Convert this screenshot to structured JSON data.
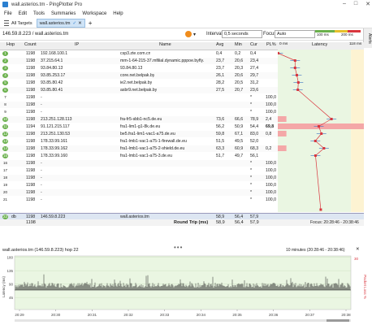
{
  "window": {
    "title": "wall.asterios.tm - PingPlotter Pro"
  },
  "menu": [
    "File",
    "Edit",
    "Tools",
    "Summaries",
    "Workspace",
    "Help"
  ],
  "tabs": {
    "all_targets": "All Targets",
    "active": "wall.asterios.tm"
  },
  "toolbar": {
    "address": "146.59.8.223 / wall.asterios.tm",
    "interval_label": "Interval",
    "interval_value": "0,5 seconds",
    "focus_label": "Focus",
    "focus_value": "Auto",
    "scale_low": "100 ms",
    "scale_high": "200 ms",
    "alerts": "Alerts"
  },
  "columns": {
    "hop": "Hop",
    "count": "Count",
    "ip": "IP",
    "name": "Name",
    "avg": "Avg",
    "min": "Min",
    "cur": "Cur",
    "pl": "PL%",
    "latency_start": "0 ms",
    "latency": "Latency",
    "latency_end": "118 ms"
  },
  "hops": [
    {
      "hop": "1",
      "count": "1198",
      "ip": "192.168.100.1",
      "name": "csp3.zte.com.cn",
      "avg": "0,4",
      "min": "0,2",
      "cur": "0,4",
      "pl": "",
      "status": "green",
      "lat": 0.4
    },
    {
      "hop": "2",
      "count": "1198",
      "ip": "37.215.64.1",
      "name": "mm-1-64-215-37.mfilial.dynamic.pppoe.byfly.",
      "avg": "23,7",
      "min": "20,6",
      "cur": "23,4",
      "pl": "",
      "status": "green",
      "lat": 23.7
    },
    {
      "hop": "3",
      "count": "1198",
      "ip": "93.84.80.13",
      "name": "93.84.80.13",
      "avg": "23,7",
      "min": "20,3",
      "cur": "27,4",
      "pl": "",
      "status": "green",
      "lat": 23.7
    },
    {
      "hop": "4",
      "count": "1198",
      "ip": "93.85.253.17",
      "name": "core.net.belpak.by",
      "avg": "26,1",
      "min": "20,6",
      "cur": "29,7",
      "pl": "",
      "status": "green",
      "lat": 26.1
    },
    {
      "hop": "5",
      "count": "1198",
      "ip": "93.85.80.42",
      "name": "ie2.net.belpak.by",
      "avg": "28,2",
      "min": "20,5",
      "cur": "31,2",
      "pl": "",
      "status": "green",
      "lat": 28.2
    },
    {
      "hop": "6",
      "count": "1198",
      "ip": "93.85.80.41",
      "name": "asbr9.net.belpak.by",
      "avg": "27,5",
      "min": "20,7",
      "cur": "23,6",
      "pl": "",
      "status": "green",
      "lat": 27.5
    },
    {
      "hop": "7",
      "count": "1198",
      "ip": "-",
      "name": "",
      "avg": "",
      "min": "",
      "cur": "*",
      "pl": "100,0",
      "status": "none",
      "lat": null
    },
    {
      "hop": "8",
      "count": "1198",
      "ip": "-",
      "name": "",
      "avg": "",
      "min": "",
      "cur": "*",
      "pl": "100,0",
      "status": "none",
      "lat": null
    },
    {
      "hop": "9",
      "count": "1198",
      "ip": "-",
      "name": "",
      "avg": "",
      "min": "",
      "cur": "*",
      "pl": "100,0",
      "status": "none",
      "lat": null
    },
    {
      "hop": "10",
      "count": "1198",
      "ip": "213.251.128.113",
      "name": "fra-fr5-sbb1-nc5.de.eu",
      "avg": "73,6",
      "min": "66,6",
      "cur": "78,9",
      "pl": "2,4",
      "status": "green",
      "lat": 73.6
    },
    {
      "hop": "11",
      "count": "1194",
      "ip": "91.121.215.117",
      "name": "fra1-lim1-g1-8k.de.eu",
      "avg": "56,2",
      "min": "50,9",
      "cur": "54,4",
      "pl": "69,8",
      "status": "green",
      "lat": 56.2
    },
    {
      "hop": "12",
      "count": "1198",
      "ip": "213.251.130.53",
      "name": "be5.fra1-lim1-vac1-a75.de.eu",
      "avg": "59,8",
      "min": "67,1",
      "cur": "83,0",
      "pl": "0,8",
      "status": "green",
      "lat": 59.8
    },
    {
      "hop": "13",
      "count": "1198",
      "ip": "178.33.99.161",
      "name": "fra1-lmb1-vac1-a75-1-firewall.de.eu",
      "avg": "51,5",
      "min": "49,5",
      "cur": "52,0",
      "pl": "",
      "status": "green",
      "lat": 51.5
    },
    {
      "hop": "14",
      "count": "1198",
      "ip": "178.33.99.162",
      "name": "fra1-lmb1-vac1-a75-2-shield.de.eu",
      "avg": "63,3",
      "min": "60,9",
      "cur": "68,3",
      "pl": "0,2",
      "status": "green",
      "lat": 63.3
    },
    {
      "hop": "15",
      "count": "1198",
      "ip": "178.33.99.160",
      "name": "fra1-lmb1-vac1-a75-3.de.eu",
      "avg": "51,7",
      "min": "49,7",
      "cur": "56,1",
      "pl": "",
      "status": "green",
      "lat": 51.7
    },
    {
      "hop": "16",
      "count": "1198",
      "ip": "-",
      "name": "",
      "avg": "",
      "min": "",
      "cur": "*",
      "pl": "100,0",
      "status": "none",
      "lat": null
    },
    {
      "hop": "17",
      "count": "1198",
      "ip": "-",
      "name": "",
      "avg": "",
      "min": "",
      "cur": "*",
      "pl": "100,0",
      "status": "none",
      "lat": null
    },
    {
      "hop": "18",
      "count": "1198",
      "ip": "-",
      "name": "",
      "avg": "",
      "min": "",
      "cur": "*",
      "pl": "100,0",
      "status": "none",
      "lat": null
    },
    {
      "hop": "19",
      "count": "1198",
      "ip": "-",
      "name": "",
      "avg": "",
      "min": "",
      "cur": "*",
      "pl": "100,0",
      "status": "none",
      "lat": null
    },
    {
      "hop": "20",
      "count": "1198",
      "ip": "-",
      "name": "",
      "avg": "",
      "min": "",
      "cur": "*",
      "pl": "100,0",
      "status": "none",
      "lat": null
    },
    {
      "hop": "21",
      "count": "1198",
      "ip": "-",
      "name": "",
      "avg": "",
      "min": "",
      "cur": "*",
      "pl": "100,0",
      "status": "none",
      "lat": null
    }
  ],
  "final_hop": {
    "hop": "22",
    "extra": "db",
    "count": "1198",
    "ip": "146.59.8.223",
    "name": "wall.asterios.tm",
    "avg": "58,9",
    "min": "56,4",
    "cur": "57,9"
  },
  "totals": {
    "count": "1198",
    "label": "Round Trip (ms)",
    "avg": "58,9",
    "min": "56,4",
    "cur": "57,9",
    "focus": "Focus: 20:28:46 - 20:38:46"
  },
  "graph": {
    "title": "wall.asterios.tm (146.59.8.223) hop 22",
    "range": "10 minutes (20:28:46 - 20:38:46)",
    "y_left_label": "Latency (ms)",
    "y_right_label": "Packet Loss %",
    "y_ticks": [
      "180",
      "135",
      "90",
      "45"
    ],
    "y_right_top": "30",
    "x_ticks": [
      "20:29",
      "20:30",
      "20:31",
      "20:32",
      "20:33",
      "20:34",
      "20:35",
      "20:36",
      "20:37",
      "20:38"
    ]
  }
}
